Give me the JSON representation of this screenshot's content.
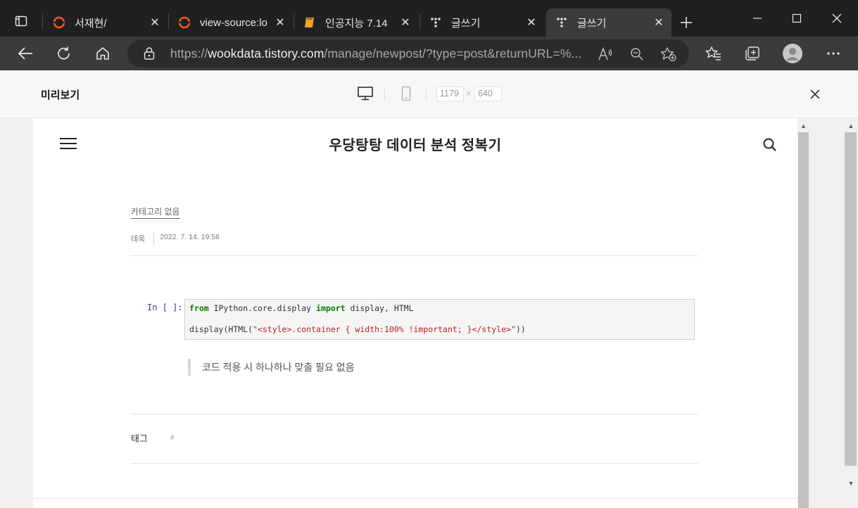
{
  "tabs": [
    {
      "title": "서재현/",
      "icon": "tistory-icon"
    },
    {
      "title": "view-source:localhost",
      "icon": "tistory-icon"
    },
    {
      "title": "인공지능 7.14",
      "icon": "book-icon"
    },
    {
      "title": "글쓰기",
      "icon": "tistory-t-icon"
    },
    {
      "title": "글쓰기",
      "icon": "tistory-t-icon"
    }
  ],
  "address": {
    "prefix": "https://",
    "host": "wookdata.tistory.com",
    "path": "/manage/newpost/?type=post&returnURL=%..."
  },
  "preview": {
    "title": "미리보기",
    "width": "1179",
    "x": "×",
    "height": "640"
  },
  "blog": {
    "title": "우당탕탕 데이터 분석 정복기",
    "category": "카테고리 없음",
    "author": "데욱",
    "date": "2022. 7. 14. 19:56",
    "prompt": "In [ ]:",
    "code": {
      "kw_from": "from",
      "module": " IPython.core.display ",
      "kw_import": "import",
      "names": " display, HTML",
      "call_open": "display(HTML(",
      "string": "\"<style>.container { width:100% !important; }</style>\"",
      "call_close": "))"
    },
    "quote": "코드 적용 시 하나하나 맞출 필요 없음",
    "tag_label": "태그",
    "tag_hash": "#"
  }
}
